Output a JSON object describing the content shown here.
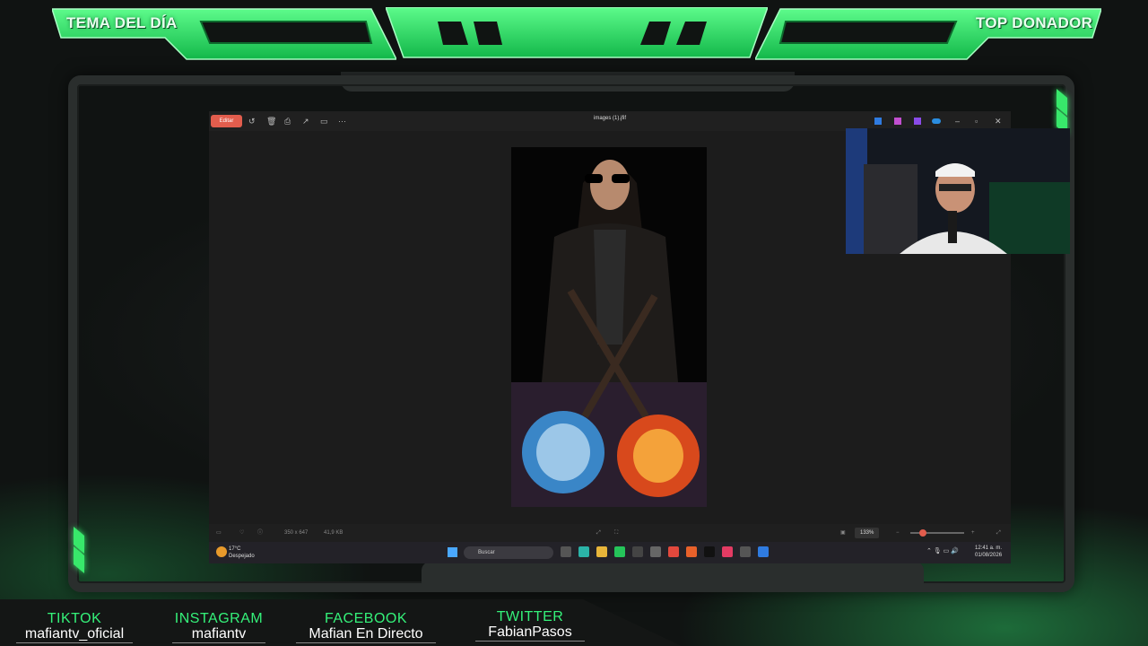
{
  "overlay": {
    "left_title": "TEMA DEL DÍA",
    "right_title": "TOP DONADOR",
    "accent": "#2ee86a"
  },
  "viewer": {
    "edit_label": "Editar",
    "title": "images (1).jfif",
    "dimensions": "350 x 647",
    "file_size": "41,9 KB",
    "zoom": "133%"
  },
  "taskbar": {
    "weather_temp": "17°C",
    "weather_desc": "Despejado",
    "search_placeholder": "Buscar",
    "time": "12:41 a. m.",
    "date": "01/08/2026"
  },
  "socials": [
    {
      "label": "TIKTOK",
      "value": "mafiantv_oficial"
    },
    {
      "label": "INSTAGRAM",
      "value": "mafiantv"
    },
    {
      "label": "FACEBOOK",
      "value": "Mafian En Directo"
    },
    {
      "label": "TWITTER",
      "value": "FabianPasos"
    }
  ]
}
